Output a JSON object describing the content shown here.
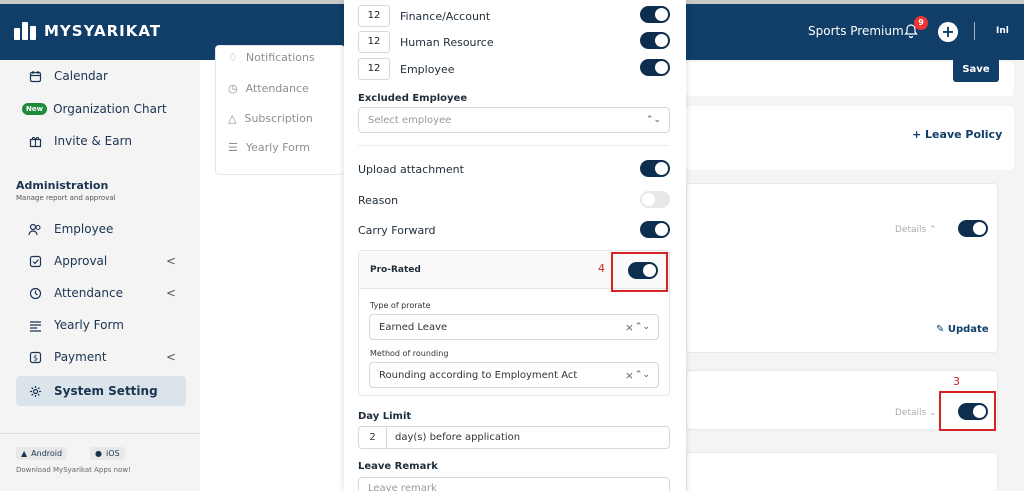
{
  "header": {
    "app_name": "MYSYARIKAT",
    "company": "Sports Premium",
    "notification_count": "9",
    "plus_label": "+",
    "user_code": "Inl"
  },
  "sidebar": {
    "items": [
      {
        "label": "Calendar",
        "icon": "calendar-icon"
      },
      {
        "label": "Organization Chart",
        "badge": "New"
      },
      {
        "label": "Invite & Earn",
        "icon": "gift-icon"
      }
    ],
    "admin_title": "Administration",
    "admin_subtitle": "Manage report and approval",
    "admin_items": [
      {
        "label": "Employee",
        "icon": "users-icon"
      },
      {
        "label": "Approval",
        "icon": "check-square-icon",
        "chevron": "<"
      },
      {
        "label": "Attendance",
        "icon": "clock-icon",
        "chevron": "<"
      },
      {
        "label": "Yearly Form",
        "icon": "form-icon"
      },
      {
        "label": "Payment",
        "icon": "dollar-icon",
        "chevron": "<"
      },
      {
        "label": "System Setting",
        "icon": "gear-icon"
      }
    ],
    "apps": {
      "android": "Android",
      "ios": "iOS",
      "note": "Download MySyarikat Apps now!"
    }
  },
  "mid_menu": {
    "items": [
      "Notifications",
      "Attendance",
      "Subscription",
      "Yearly Form"
    ]
  },
  "right": {
    "save": "Save",
    "leave_policy": "+ Leave Policy",
    "details": "Details",
    "update": "Update"
  },
  "modal": {
    "roles": [
      {
        "count": "12",
        "label": "Finance/Account",
        "on": true
      },
      {
        "count": "12",
        "label": "Human Resource",
        "on": true
      },
      {
        "count": "12",
        "label": "Employee",
        "on": true
      }
    ],
    "excluded_label": "Excluded Employee",
    "excluded_placeholder": "Select employee",
    "upload_label": "Upload attachment",
    "reason_label": "Reason",
    "carry_label": "Carry Forward",
    "prorated_label": "Pro-Rated",
    "prorate_type_label": "Type of prorate",
    "prorate_type_value": "Earned Leave",
    "rounding_label": "Method of rounding",
    "rounding_value": "Rounding according to Employment Act",
    "day_limit_label": "Day Limit",
    "day_limit_value": "2",
    "day_limit_suffix": "day(s) before application",
    "remark_label": "Leave Remark",
    "remark_placeholder": "Leave remark"
  },
  "annotations": {
    "box3": "3",
    "box4": "4"
  },
  "colors": {
    "navy": "#103e68",
    "toggle": "#0e2e4f",
    "sidebar_bg": "#f4f4f4",
    "annotation": "#d62222"
  }
}
